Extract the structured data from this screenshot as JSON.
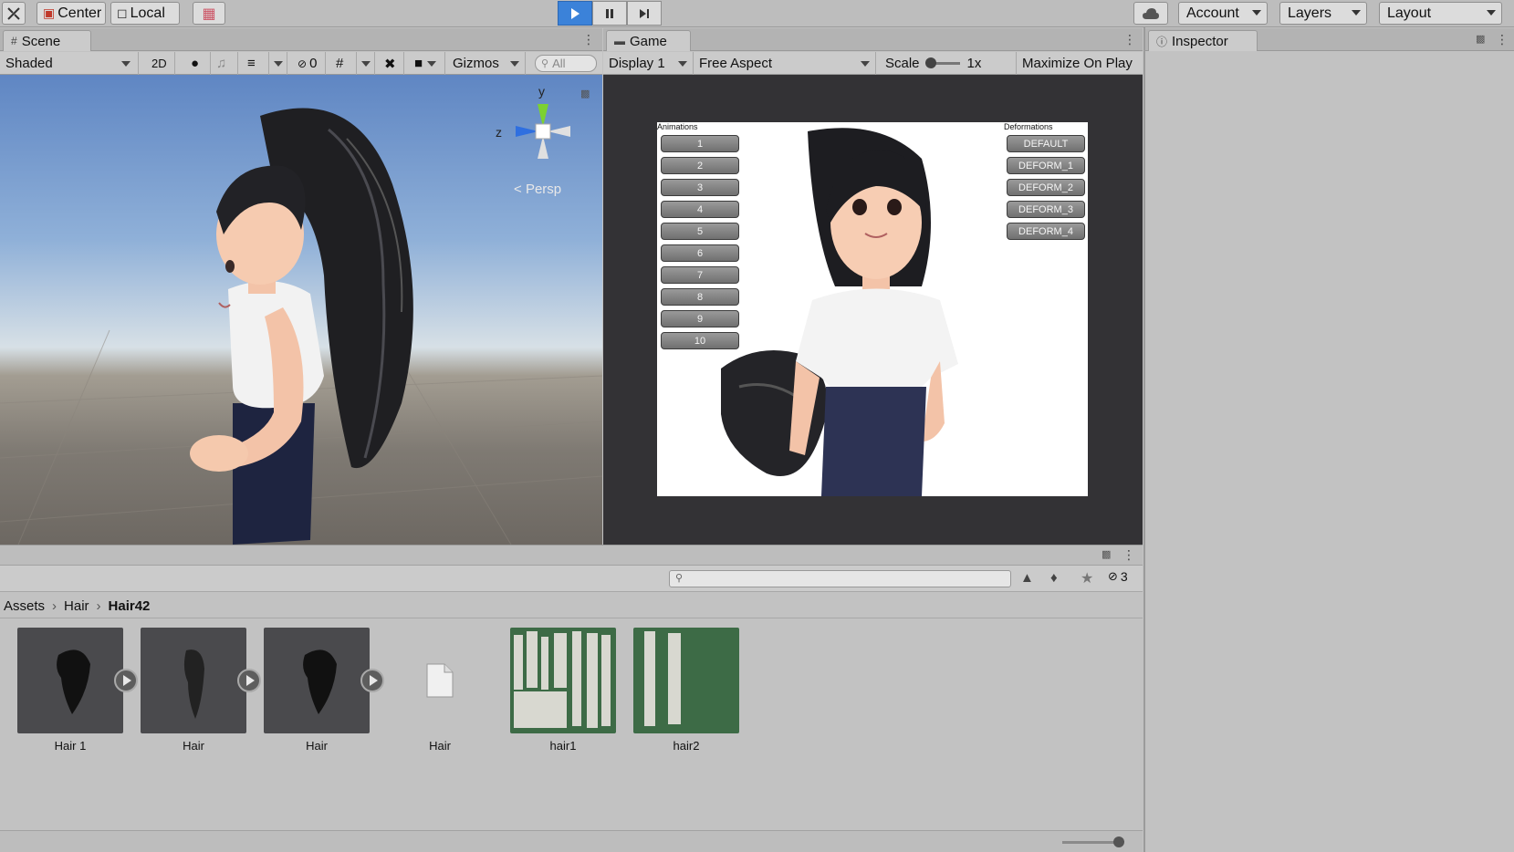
{
  "toolbar": {
    "center_label": "Center",
    "local_label": "Local",
    "account_label": "Account",
    "layers_label": "Layers",
    "layout_label": "Layout"
  },
  "scene": {
    "tab_label": "Scene",
    "shading_mode": "Shaded",
    "mode_2d": "2D",
    "hidden_count": "0",
    "gizmos_label": "Gizmos",
    "search_placeholder": "All",
    "gizmo_y": "y",
    "gizmo_z": "z",
    "persp_label": "Persp"
  },
  "game": {
    "tab_label": "Game",
    "display": "Display 1",
    "aspect": "Free Aspect",
    "scale_label": "Scale",
    "scale_value": "1x",
    "maximize_label": "Maximize On Play",
    "animations_title": "Animations",
    "animation_buttons": [
      "1",
      "2",
      "3",
      "4",
      "5",
      "6",
      "7",
      "8",
      "9",
      "10"
    ],
    "deformations_title": "Deformations",
    "deformation_buttons": [
      "DEFAULT",
      "DEFORM_1",
      "DEFORM_2",
      "DEFORM_3",
      "DEFORM_4"
    ]
  },
  "inspector": {
    "tab_label": "Inspector"
  },
  "project": {
    "breadcrumb": [
      "Assets",
      "Hair",
      "Hair42"
    ],
    "hidden_count": "3",
    "assets": [
      {
        "label": "Hair 1",
        "kind": "model"
      },
      {
        "label": "Hair",
        "kind": "model"
      },
      {
        "label": "Hair",
        "kind": "model"
      },
      {
        "label": "Hair",
        "kind": "file"
      },
      {
        "label": "hair1",
        "kind": "texture"
      },
      {
        "label": "hair2",
        "kind": "texture"
      }
    ]
  },
  "colors": {
    "play_active": "#3b82d9",
    "texture_bg": "#3d6b46",
    "game_bg": "#333235"
  }
}
